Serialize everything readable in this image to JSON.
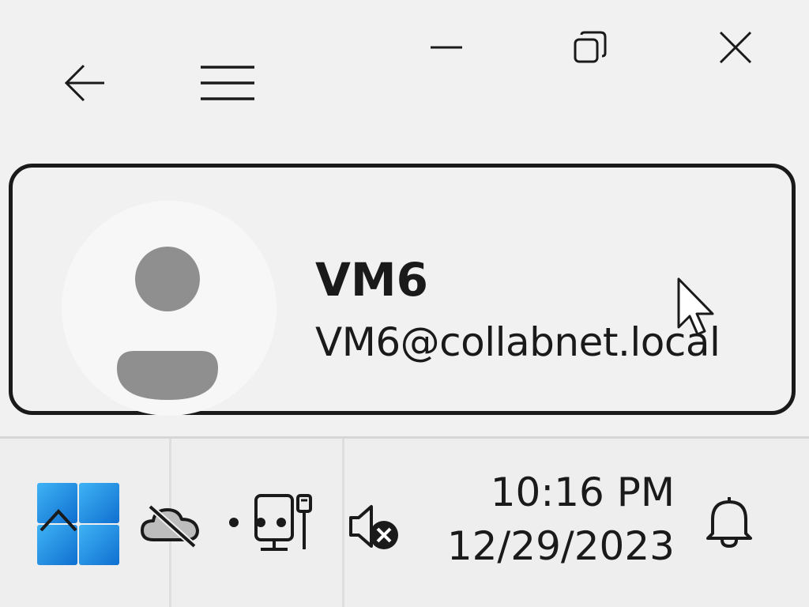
{
  "titlebar": {
    "back_icon": "arrow-left-icon",
    "menu_icon": "hamburger-menu-icon",
    "minimize_icon": "minimize-icon",
    "restore_icon": "restore-icon",
    "close_icon": "close-icon"
  },
  "account": {
    "name": "VM6",
    "email": "VM6@collabnet.local",
    "avatar_icon": "user-avatar-icon"
  },
  "taskbar": {
    "start_icon": "windows-start-icon",
    "chevron_icon": "chevron-up-icon",
    "onedrive_icon": "onedrive-offline-icon",
    "network_icon": "network-ethernet-icon",
    "volume_icon": "volume-muted-icon",
    "notification_icon": "bell-icon",
    "clock": {
      "time": "10:16 PM",
      "date": "12/29/2023"
    }
  },
  "colors": {
    "start_blue": "#1f8fe6",
    "card_border": "#1a1a1a",
    "avatar_gray": "#8f8f8f"
  }
}
